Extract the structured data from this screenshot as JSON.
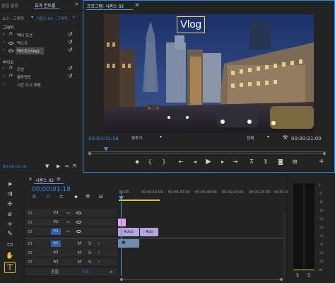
{
  "source_panel": {
    "tab_partial": "클립 없음",
    "tab_active": "효과 컨트롤",
    "menu_icon": "double-chevron-right-icon",
    "header_source": "소스 - 그래픽",
    "header_sequence": "시퀀스 02 - 그래픽",
    "section_graphic": "그래픽",
    "rows": [
      {
        "label": "벡터 모션"
      },
      {
        "label": "텍스트"
      },
      {
        "label": "텍스트(Vlog)"
      }
    ],
    "section_video": "비디오",
    "video_rows": [
      {
        "label": "모션"
      },
      {
        "label": "불투명도"
      },
      {
        "label": "시간 다시 매핑"
      }
    ],
    "timecode": "00:00:01:18"
  },
  "program_monitor": {
    "tab": "프로그램: 시퀀스 02",
    "overlay_text": "Vlog",
    "timecode_left": "00:00:01:18",
    "fit_label": "맞추기",
    "quality_label": "전체",
    "timecode_right": "00:00:21:00"
  },
  "timeline": {
    "close_icon": "×",
    "tab": "시퀀스 02",
    "timecode": "00:00:01:18",
    "ruler": [
      "00:00",
      "00:00:16:00",
      "00:00:32:00",
      "00:00:48:00",
      "00:01:04:00",
      "00:01:20:00",
      "00:01:36:00"
    ],
    "video_tracks": [
      "V3",
      "V2",
      "V1"
    ],
    "audio_tracks": [
      "A1",
      "A2",
      "A3"
    ],
    "mute_label": "M",
    "solo_label": "S",
    "mix_label": "혼합",
    "mix_value": "0.0",
    "clip_label": "Adob",
    "clip_label_2": "Ado"
  },
  "meter": {
    "scale": [
      "0",
      "-6",
      "-12",
      "-18",
      "-24",
      "-30",
      "-36",
      "-42",
      "-48",
      "-54",
      "dB"
    ],
    "solo_labels": [
      "S",
      "S"
    ]
  },
  "colors": {
    "accent": "#2d8ceb",
    "playhead": "#4a8fd8",
    "tool_highlight": "#e0c23c",
    "video_clip": "#b6a6e0",
    "audio_clip": "#6e8cb1"
  }
}
